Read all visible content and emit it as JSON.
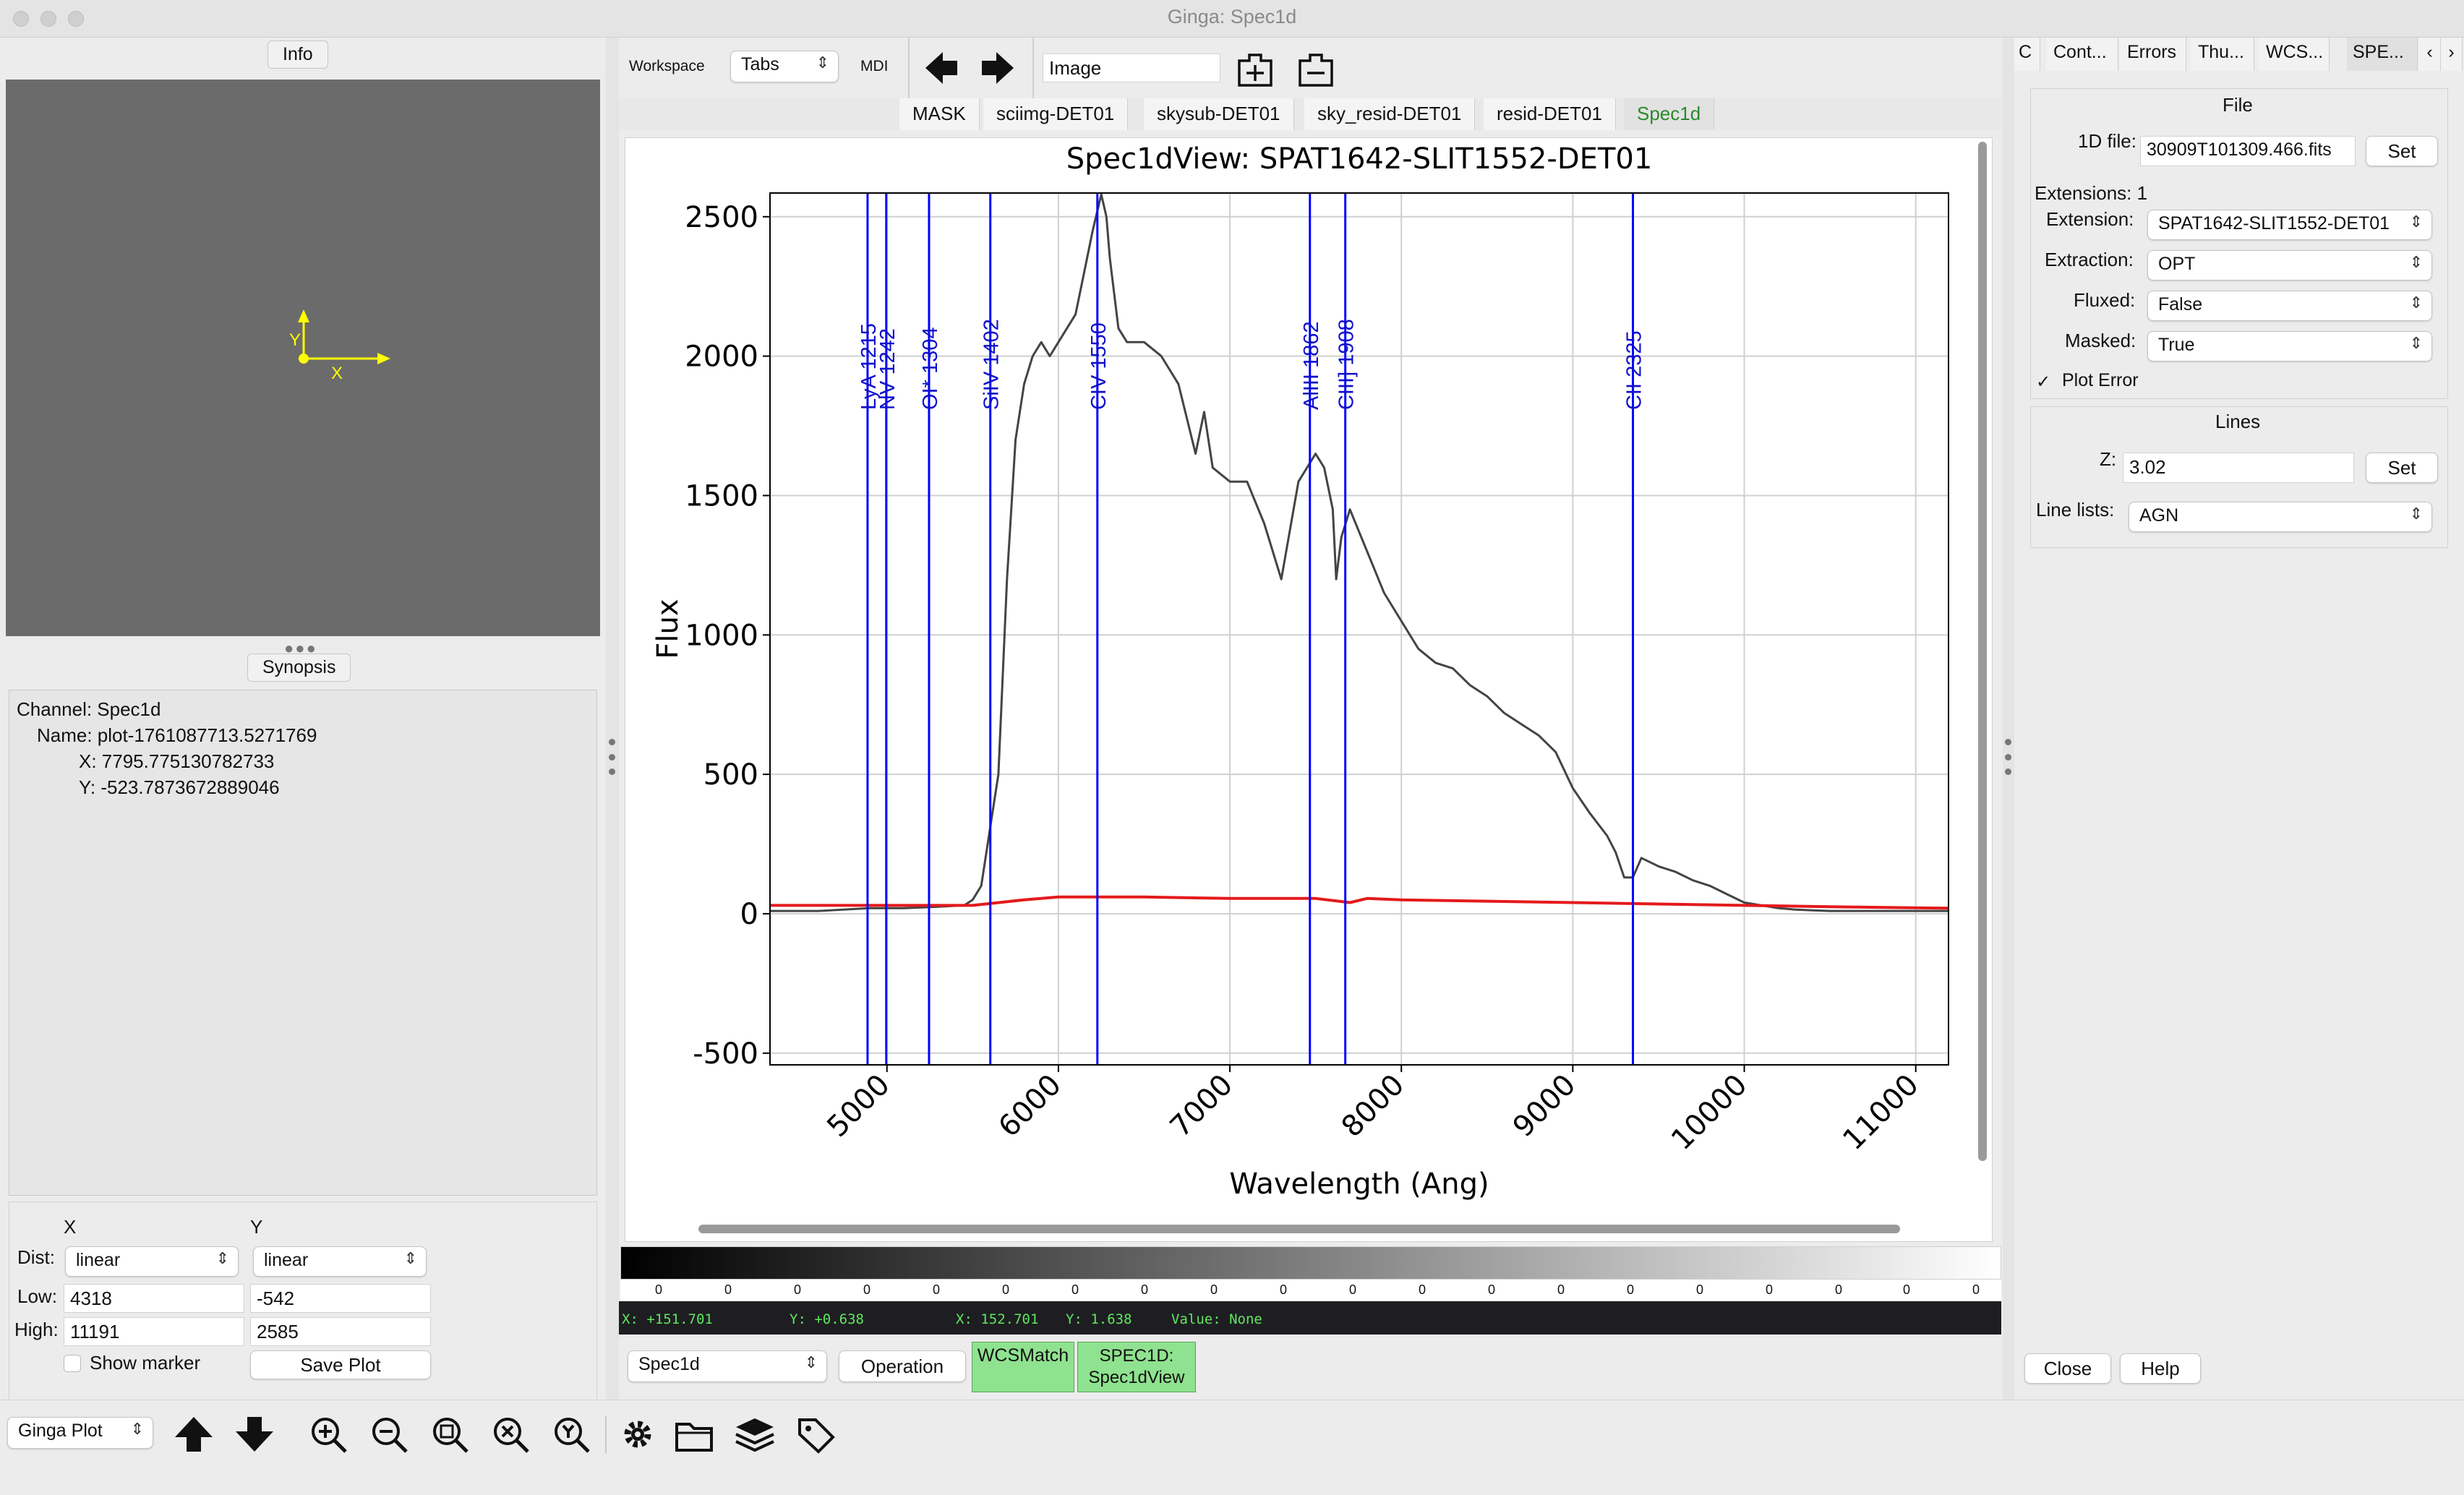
{
  "window": {
    "title": "Ginga: Spec1d"
  },
  "left": {
    "info_label": "Info",
    "synopsis_label": "Synopsis",
    "synopsis": {
      "channel": "Channel: Spec1d",
      "name": "Name: plot-1761087713.5271769",
      "x": "X: 7795.775130782733",
      "y": "Y: -523.7873672889046"
    },
    "axis_icon": {
      "x": "X",
      "y": "Y"
    },
    "controls": {
      "col_x": "X",
      "col_y": "Y",
      "dist_label": "Dist:",
      "dist_x": "linear",
      "dist_y": "linear",
      "low_label": "Low:",
      "low_x": "4318",
      "low_y": "-542",
      "high_label": "High:",
      "high_x": "11191",
      "high_y": "2585",
      "show_marker": "Show marker",
      "save_plot": "Save Plot"
    }
  },
  "toolbar": {
    "workspace_label": "Workspace",
    "workspace_value": "Tabs",
    "mdi_label": "MDI",
    "image_input": "Image"
  },
  "tabs": [
    {
      "label": "MASK"
    },
    {
      "label": "sciimg-DET01"
    },
    {
      "label": "skysub-DET01"
    },
    {
      "label": "sky_resid-DET01"
    },
    {
      "label": "resid-DET01"
    },
    {
      "label": "Spec1d"
    }
  ],
  "chart_data": {
    "type": "line",
    "title": "Spec1dView: SPAT1642-SLIT1552-DET01",
    "xlabel": "Wavelength (Ang)",
    "ylabel": "Flux",
    "xlim": [
      4318,
      11191
    ],
    "ylim": [
      -542,
      2585
    ],
    "xticks": [
      5000,
      6000,
      7000,
      8000,
      9000,
      10000,
      11000
    ],
    "yticks": [
      -500,
      0,
      500,
      1000,
      1500,
      2000,
      2500
    ],
    "grid": true,
    "series": [
      {
        "color": "#444444",
        "x": [
          4318,
          4600,
          4900,
          5100,
          5300,
          5450,
          5500,
          5550,
          5600,
          5650,
          5700,
          5750,
          5800,
          5850,
          5900,
          5950,
          6000,
          6100,
          6150,
          6200,
          6250,
          6280,
          6300,
          6350,
          6400,
          6500,
          6600,
          6700,
          6800,
          6850,
          6900,
          7000,
          7100,
          7200,
          7300,
          7400,
          7450,
          7500,
          7550,
          7600,
          7620,
          7650,
          7700,
          7800,
          7900,
          8000,
          8100,
          8200,
          8300,
          8400,
          8500,
          8600,
          8700,
          8800,
          8900,
          9000,
          9100,
          9200,
          9250,
          9300,
          9350,
          9400,
          9500,
          9600,
          9700,
          9800,
          9900,
          10000,
          10100,
          10200,
          10300,
          10400,
          10500,
          10600,
          10800,
          11000,
          11191
        ],
        "y": [
          10,
          10,
          20,
          20,
          25,
          30,
          50,
          100,
          300,
          500,
          1200,
          1700,
          1900,
          2000,
          2050,
          2000,
          2050,
          2150,
          2300,
          2450,
          2580,
          2500,
          2350,
          2100,
          2050,
          2050,
          2000,
          1900,
          1650,
          1800,
          1600,
          1550,
          1550,
          1400,
          1200,
          1550,
          1600,
          1650,
          1600,
          1450,
          1200,
          1350,
          1450,
          1300,
          1150,
          1050,
          950,
          900,
          880,
          820,
          780,
          720,
          680,
          640,
          580,
          450,
          360,
          280,
          220,
          130,
          130,
          200,
          170,
          150,
          120,
          100,
          70,
          40,
          30,
          20,
          15,
          12,
          10,
          10,
          10,
          10,
          10
        ]
      },
      {
        "color": "#e41a1c",
        "x": [
          4318,
          5000,
          5500,
          5800,
          6000,
          6500,
          7000,
          7500,
          7700,
          7800,
          8000,
          8500,
          9000,
          9500,
          10000,
          10500,
          11191
        ],
        "y": [
          30,
          30,
          30,
          50,
          60,
          60,
          55,
          55,
          40,
          55,
          50,
          45,
          40,
          35,
          30,
          25,
          20
        ]
      }
    ],
    "lines": [
      {
        "label": "LyA 1215",
        "wave": 1215.67
      },
      {
        "label": "NV 1242",
        "wave": 1242.8
      },
      {
        "label": "OI* 1304",
        "wave": 1304.86
      },
      {
        "label": "SiIV 1402",
        "wave": 1393.76
      },
      {
        "label": "CIV 1550",
        "wave": 1549.06
      },
      {
        "label": "AlIII 1862",
        "wave": 1857.4
      },
      {
        "label": "CIII] 1908",
        "wave": 1908.73
      },
      {
        "label": "CII 2325",
        "wave": 2326
      }
    ],
    "z": 3.02
  },
  "colorbar": {
    "ticks": [
      "0",
      "0",
      "0",
      "0",
      "0",
      "0",
      "0",
      "0",
      "0",
      "0",
      "0",
      "0",
      "0",
      "0",
      "0",
      "0",
      "0",
      "0",
      "0",
      "0"
    ]
  },
  "status": {
    "x1": "X: +151.701",
    "y1": "Y: +0.638",
    "x2": "X: 152.701",
    "y2": "Y: 1.638",
    "value": "Value: None"
  },
  "bottom": {
    "channel": "Spec1d",
    "operation": "Operation",
    "wcsmatch": "WCSMatch",
    "spec1d_l1": "SPEC1D:",
    "spec1d_l2": "Spec1dView",
    "ginga_plot": "Ginga Plot"
  },
  "right": {
    "tabs": [
      {
        "label": "C"
      },
      {
        "label": "Cont..."
      },
      {
        "label": "Errors"
      },
      {
        "label": "Thu..."
      },
      {
        "label": "WCS..."
      },
      {
        "label": "SPE..."
      }
    ],
    "file_header": "File",
    "file_label": "1D file:",
    "file_value": "30909T101309.466.fits",
    "set": "Set",
    "extensions": "Extensions: 1",
    "extension_label": "Extension:",
    "extension_value": "SPAT1642-SLIT1552-DET01",
    "extraction_label": "Extraction:",
    "extraction_value": "OPT",
    "fluxed_label": "Fluxed:",
    "fluxed_value": "False",
    "masked_label": "Masked:",
    "masked_value": "True",
    "plot_error": "Plot Error",
    "lines_header": "Lines",
    "z_label": "Z:",
    "z_value": "3.02",
    "line_lists_label": "Line lists:",
    "line_lists_value": "AGN",
    "close": "Close",
    "help": "Help"
  }
}
